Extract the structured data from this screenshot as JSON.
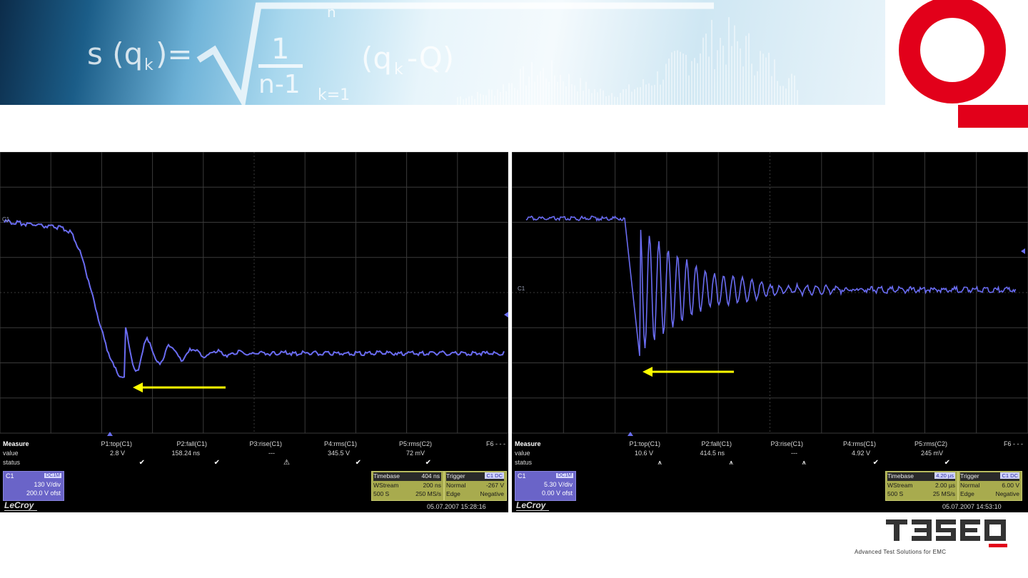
{
  "banner": {
    "formula": {
      "lhs": "s (q",
      "lhs_sub": "k",
      "lhs_close": ")=",
      "numerator": "1",
      "denominator": "n-1",
      "sum_sup": "n",
      "sum_sub": "k=1",
      "rhs": "(q",
      "rhs_sub": "k",
      "rhs_tail": "-Q)"
    }
  },
  "colors": {
    "brand_red": "#e2001a",
    "trace": "#6a6cf2",
    "arrow": "#ffff00",
    "timebase_box": "#a8ab4e",
    "channel_box": "#6a64c8"
  },
  "scopes": [
    {
      "channel_marker": "C1",
      "measure": {
        "title": "Measure",
        "row_value": "value",
        "row_status": "status",
        "columns": [
          {
            "name": "P1:top(C1)",
            "value": "2.8 V",
            "status": "✔"
          },
          {
            "name": "P2:fall(C1)",
            "value": "158.24 ns",
            "status": "✔"
          },
          {
            "name": "P3:rise(C1)",
            "value": "---",
            "status": "⚠"
          },
          {
            "name": "P4:rms(C1)",
            "value": "345.5 V",
            "status": "✔"
          },
          {
            "name": "P5:rms(C2)",
            "value": "72 mV",
            "status": "✔"
          },
          {
            "name": "F6 - - -",
            "value": "",
            "status": ""
          }
        ]
      },
      "channel_box": {
        "name": "C1",
        "coupling": "DC1M",
        "scale": "130 V/div",
        "offset": "200.0 V ofst"
      },
      "timebase": {
        "label": "Timebase",
        "value": "404 ns",
        "stream_label": "WStream",
        "stream_value": "200 ns",
        "samples": "500 S",
        "rate": "250 MS/s"
      },
      "trigger": {
        "label": "Trigger",
        "source": "C1 DC",
        "mode": "Normal",
        "level": "-267 V",
        "type": "Edge",
        "slope": "Negative"
      },
      "brand": "LeCroy",
      "timestamp": "05.07.2007 15:28:16"
    },
    {
      "channel_marker": "C1",
      "measure": {
        "title": "Measure",
        "row_value": "value",
        "row_status": "status",
        "columns": [
          {
            "name": "P1:top(C1)",
            "value": "10.6 V",
            "status": "⩚"
          },
          {
            "name": "P2:fall(C1)",
            "value": "414.5 ns",
            "status": "⩚"
          },
          {
            "name": "P3:rise(C1)",
            "value": "---",
            "status": "⩚"
          },
          {
            "name": "P4:rms(C1)",
            "value": "4.92 V",
            "status": "✔"
          },
          {
            "name": "P5:rms(C2)",
            "value": "245 mV",
            "status": "✔"
          },
          {
            "name": "F6 - - -",
            "value": "",
            "status": ""
          }
        ]
      },
      "channel_box": {
        "name": "C1",
        "coupling": "DC1M",
        "scale": "5.30 V/div",
        "offset": "0.00 V ofst"
      },
      "timebase": {
        "label": "Timebase",
        "value": "4.20 µs",
        "stream_label": "WStream",
        "stream_value": "2.00 µs",
        "samples": "500 S",
        "rate": "25 MS/s"
      },
      "trigger": {
        "label": "Trigger",
        "source": "C1 DC",
        "mode": "Normal",
        "level": "6.00 V",
        "type": "Edge",
        "slope": "Negative"
      },
      "brand": "LeCroy",
      "timestamp": "05.07.2007 14:53:10"
    }
  ],
  "logo": {
    "name": "TESEO",
    "tagline": "Advanced Test Solutions for EMC"
  }
}
